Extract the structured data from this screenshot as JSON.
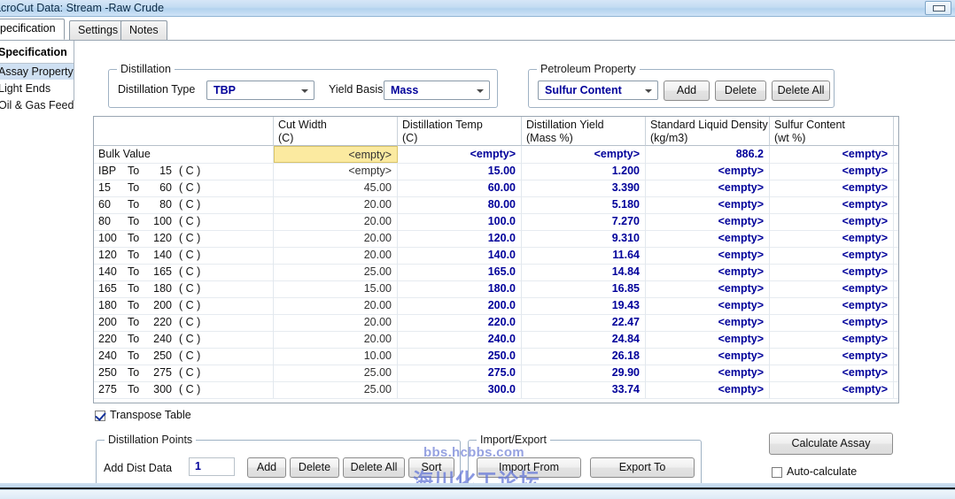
{
  "window": {
    "title": "acroCut Data: Stream -Raw Crude",
    "minimize_icon": "minimize-icon"
  },
  "tabs": [
    {
      "label": "pecification",
      "active": true
    },
    {
      "label": "Settings",
      "active": false
    },
    {
      "label": "Notes",
      "active": false
    }
  ],
  "sidebar": {
    "title": "Specification",
    "items": [
      {
        "label": "Assay Property",
        "selected": true
      },
      {
        "label": "Light Ends",
        "selected": false
      },
      {
        "label": "Oil & Gas Feed",
        "selected": false
      }
    ]
  },
  "distillation_group": {
    "legend": "Distillation",
    "distillation_type_label": "Distillation Type",
    "distillation_type_value": "TBP",
    "yield_basis_label": "Yield Basis",
    "yield_basis_value": "Mass"
  },
  "petroleum_property_group": {
    "legend": "Petroleum Property",
    "property_value": "Sulfur Content",
    "add_label": "Add",
    "delete_label": "Delete",
    "delete_all_label": "Delete All"
  },
  "grid": {
    "columns": [
      {
        "line1": "",
        "line2": ""
      },
      {
        "line1": "Cut Width",
        "line2": "(C)"
      },
      {
        "line1": "Distillation Temp",
        "line2": "(C)"
      },
      {
        "line1": "Distillation Yield",
        "line2": "(Mass %)"
      },
      {
        "line1": "Standard Liquid Density",
        "line2": "(kg/m3)"
      },
      {
        "line1": "Sulfur Content",
        "line2": "(wt %)"
      }
    ],
    "empty_token": "<empty>",
    "rows": [
      {
        "label": "Bulk Value",
        "from": "",
        "to": "",
        "unit": "",
        "cut_width": "<empty>",
        "dist_temp": "<empty>",
        "dist_yield": "<empty>",
        "density": "886.2",
        "sulfur": "<empty>",
        "selected": true
      },
      {
        "label": "",
        "from": "IBP",
        "to": "15",
        "unit": "( C )",
        "cut_width": "<empty>",
        "dist_temp": "15.00",
        "dist_yield": "1.200",
        "density": "<empty>",
        "sulfur": "<empty>",
        "selected": false
      },
      {
        "label": "",
        "from": "15",
        "to": "60",
        "unit": "( C )",
        "cut_width": "45.00",
        "dist_temp": "60.00",
        "dist_yield": "3.390",
        "density": "<empty>",
        "sulfur": "<empty>",
        "selected": false
      },
      {
        "label": "",
        "from": "60",
        "to": "80",
        "unit": "( C )",
        "cut_width": "20.00",
        "dist_temp": "80.00",
        "dist_yield": "5.180",
        "density": "<empty>",
        "sulfur": "<empty>",
        "selected": false
      },
      {
        "label": "",
        "from": "80",
        "to": "100",
        "unit": "( C )",
        "cut_width": "20.00",
        "dist_temp": "100.0",
        "dist_yield": "7.270",
        "density": "<empty>",
        "sulfur": "<empty>",
        "selected": false
      },
      {
        "label": "",
        "from": "100",
        "to": "120",
        "unit": "( C )",
        "cut_width": "20.00",
        "dist_temp": "120.0",
        "dist_yield": "9.310",
        "density": "<empty>",
        "sulfur": "<empty>",
        "selected": false
      },
      {
        "label": "",
        "from": "120",
        "to": "140",
        "unit": "( C )",
        "cut_width": "20.00",
        "dist_temp": "140.0",
        "dist_yield": "11.64",
        "density": "<empty>",
        "sulfur": "<empty>",
        "selected": false
      },
      {
        "label": "",
        "from": "140",
        "to": "165",
        "unit": "( C )",
        "cut_width": "25.00",
        "dist_temp": "165.0",
        "dist_yield": "14.84",
        "density": "<empty>",
        "sulfur": "<empty>",
        "selected": false
      },
      {
        "label": "",
        "from": "165",
        "to": "180",
        "unit": "( C )",
        "cut_width": "15.00",
        "dist_temp": "180.0",
        "dist_yield": "16.85",
        "density": "<empty>",
        "sulfur": "<empty>",
        "selected": false
      },
      {
        "label": "",
        "from": "180",
        "to": "200",
        "unit": "( C )",
        "cut_width": "20.00",
        "dist_temp": "200.0",
        "dist_yield": "19.43",
        "density": "<empty>",
        "sulfur": "<empty>",
        "selected": false
      },
      {
        "label": "",
        "from": "200",
        "to": "220",
        "unit": "( C )",
        "cut_width": "20.00",
        "dist_temp": "220.0",
        "dist_yield": "22.47",
        "density": "<empty>",
        "sulfur": "<empty>",
        "selected": false
      },
      {
        "label": "",
        "from": "220",
        "to": "240",
        "unit": "( C )",
        "cut_width": "20.00",
        "dist_temp": "240.0",
        "dist_yield": "24.84",
        "density": "<empty>",
        "sulfur": "<empty>",
        "selected": false
      },
      {
        "label": "",
        "from": "240",
        "to": "250",
        "unit": "( C )",
        "cut_width": "10.00",
        "dist_temp": "250.0",
        "dist_yield": "26.18",
        "density": "<empty>",
        "sulfur": "<empty>",
        "selected": false
      },
      {
        "label": "",
        "from": "250",
        "to": "275",
        "unit": "( C )",
        "cut_width": "25.00",
        "dist_temp": "275.0",
        "dist_yield": "29.90",
        "density": "<empty>",
        "sulfur": "<empty>",
        "selected": false
      },
      {
        "label": "",
        "from": "275",
        "to": "300",
        "unit": "( C )",
        "cut_width": "25.00",
        "dist_temp": "300.0",
        "dist_yield": "33.74",
        "density": "<empty>",
        "sulfur": "<empty>",
        "selected": false
      }
    ]
  },
  "transpose": {
    "label": "Transpose Table",
    "checked": true
  },
  "distillation_points_group": {
    "legend": "Distillation Points",
    "add_dist_data_label": "Add Dist Data",
    "add_dist_data_value": "1",
    "add_label": "Add",
    "delete_label": "Delete",
    "delete_all_label": "Delete All",
    "sort_label": "Sort"
  },
  "import_export_group": {
    "legend": "Import/Export",
    "import_label": "Import From",
    "export_label": "Export To"
  },
  "actions": {
    "calculate_label": "Calculate Assay",
    "auto_calculate_label": "Auto-calculate",
    "auto_calculate_checked": false
  },
  "watermark": {
    "line1": "bbs.hcbbs.com",
    "line2": "海川化工论坛"
  },
  "colors": {
    "value_blue": "#00009a",
    "selection_yellow": "#fbeaa0",
    "title_blue": "#b3d2ee"
  }
}
